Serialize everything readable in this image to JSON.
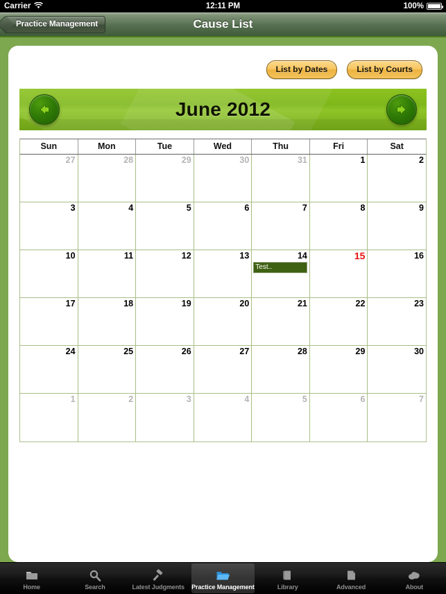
{
  "status_bar": {
    "carrier": "Carrier",
    "wifi_icon": "wifi-icon",
    "time": "12:11 PM",
    "battery_percent": "100%",
    "battery_icon": "battery-full-icon"
  },
  "nav_bar": {
    "back_label": "Practice Management",
    "title": "Cause List"
  },
  "toolbar": {
    "list_by_dates_label": "List by Dates",
    "list_by_courts_label": "List by Courts"
  },
  "calendar": {
    "month_title": "June 2012",
    "prev_icon": "arrow-left-icon",
    "next_icon": "arrow-right-icon",
    "weekdays": [
      "Sun",
      "Mon",
      "Tue",
      "Wed",
      "Thu",
      "Fri",
      "Sat"
    ],
    "weeks": [
      [
        {
          "day": "27",
          "other_month": true,
          "today": false,
          "events": []
        },
        {
          "day": "28",
          "other_month": true,
          "today": false,
          "events": []
        },
        {
          "day": "29",
          "other_month": true,
          "today": false,
          "events": []
        },
        {
          "day": "30",
          "other_month": true,
          "today": false,
          "events": []
        },
        {
          "day": "31",
          "other_month": true,
          "today": false,
          "events": []
        },
        {
          "day": "1",
          "other_month": false,
          "today": false,
          "events": []
        },
        {
          "day": "2",
          "other_month": false,
          "today": false,
          "events": []
        }
      ],
      [
        {
          "day": "3",
          "other_month": false,
          "today": false,
          "events": []
        },
        {
          "day": "4",
          "other_month": false,
          "today": false,
          "events": []
        },
        {
          "day": "5",
          "other_month": false,
          "today": false,
          "events": []
        },
        {
          "day": "6",
          "other_month": false,
          "today": false,
          "events": []
        },
        {
          "day": "7",
          "other_month": false,
          "today": false,
          "events": []
        },
        {
          "day": "8",
          "other_month": false,
          "today": false,
          "events": []
        },
        {
          "day": "9",
          "other_month": false,
          "today": false,
          "events": []
        }
      ],
      [
        {
          "day": "10",
          "other_month": false,
          "today": false,
          "events": []
        },
        {
          "day": "11",
          "other_month": false,
          "today": false,
          "events": []
        },
        {
          "day": "12",
          "other_month": false,
          "today": false,
          "events": []
        },
        {
          "day": "13",
          "other_month": false,
          "today": false,
          "events": []
        },
        {
          "day": "14",
          "other_month": false,
          "today": false,
          "events": [
            "Test.."
          ]
        },
        {
          "day": "15",
          "other_month": false,
          "today": true,
          "events": []
        },
        {
          "day": "16",
          "other_month": false,
          "today": false,
          "events": []
        }
      ],
      [
        {
          "day": "17",
          "other_month": false,
          "today": false,
          "events": []
        },
        {
          "day": "18",
          "other_month": false,
          "today": false,
          "events": []
        },
        {
          "day": "19",
          "other_month": false,
          "today": false,
          "events": []
        },
        {
          "day": "20",
          "other_month": false,
          "today": false,
          "events": []
        },
        {
          "day": "21",
          "other_month": false,
          "today": false,
          "events": []
        },
        {
          "day": "22",
          "other_month": false,
          "today": false,
          "events": []
        },
        {
          "day": "23",
          "other_month": false,
          "today": false,
          "events": []
        }
      ],
      [
        {
          "day": "24",
          "other_month": false,
          "today": false,
          "events": []
        },
        {
          "day": "25",
          "other_month": false,
          "today": false,
          "events": []
        },
        {
          "day": "26",
          "other_month": false,
          "today": false,
          "events": []
        },
        {
          "day": "27",
          "other_month": false,
          "today": false,
          "events": []
        },
        {
          "day": "28",
          "other_month": false,
          "today": false,
          "events": []
        },
        {
          "day": "29",
          "other_month": false,
          "today": false,
          "events": []
        },
        {
          "day": "30",
          "other_month": false,
          "today": false,
          "events": []
        }
      ],
      [
        {
          "day": "1",
          "other_month": true,
          "today": false,
          "events": []
        },
        {
          "day": "2",
          "other_month": true,
          "today": false,
          "events": []
        },
        {
          "day": "3",
          "other_month": true,
          "today": false,
          "events": []
        },
        {
          "day": "4",
          "other_month": true,
          "today": false,
          "events": []
        },
        {
          "day": "5",
          "other_month": true,
          "today": false,
          "events": []
        },
        {
          "day": "6",
          "other_month": true,
          "today": false,
          "events": []
        },
        {
          "day": "7",
          "other_month": true,
          "today": false,
          "events": []
        }
      ]
    ]
  },
  "tab_bar": {
    "tabs": [
      {
        "label": "Home",
        "icon": "folder-icon",
        "selected": false
      },
      {
        "label": "Search",
        "icon": "magnifier-icon",
        "selected": false
      },
      {
        "label": "Latest Judgments",
        "icon": "gavel-icon",
        "selected": false
      },
      {
        "label": "Practice Management",
        "icon": "open-folder-blue-icon",
        "selected": true
      },
      {
        "label": "Library",
        "icon": "book-icon",
        "selected": false
      },
      {
        "label": "Advanced",
        "icon": "document-icon",
        "selected": false
      },
      {
        "label": "About",
        "icon": "cloud-icon",
        "selected": false
      }
    ]
  },
  "colors": {
    "page_background": "#7ea84f",
    "banner_green": "#8cc220",
    "nav_bar_green": "#566f50",
    "button_amber": "#f3c45d",
    "event_green": "#3f6112",
    "today_red": "#e8110f",
    "grid_line": "#a9bd86"
  }
}
